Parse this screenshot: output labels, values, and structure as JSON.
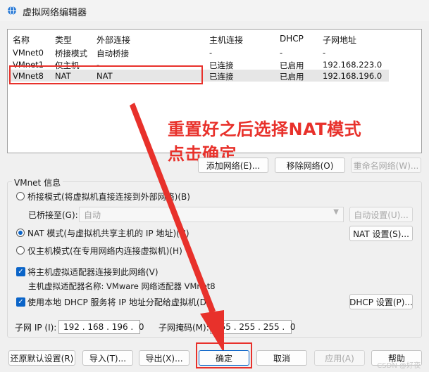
{
  "window": {
    "title": "虚拟网络编辑器",
    "icon": "globe-icon"
  },
  "table": {
    "headers": [
      "名称",
      "类型",
      "外部连接",
      "主机连接",
      "DHCP",
      "子网地址"
    ],
    "rows": [
      [
        "VMnet0",
        "桥接模式",
        "自动桥接",
        "-",
        "-",
        "-"
      ],
      [
        "VMnet1",
        "仅主机",
        "-",
        "已连接",
        "已启用",
        "192.168.223.0"
      ],
      [
        "VMnet8",
        "NAT",
        "NAT",
        "已连接",
        "已启用",
        "192.168.196.0"
      ]
    ],
    "selected_row": 2
  },
  "annotation": {
    "line1": "重置好之后选择NAT模式",
    "line2": "点击确定",
    "color": "#e8312b"
  },
  "network_buttons": {
    "add": "添加网络(E)...",
    "remove": "移除网络(O)",
    "rename": "重命名网络(W)..."
  },
  "vmnet_info": {
    "label": "VMnet 信息",
    "bridge_option": "桥接模式(将虚拟机直接连接到外部网络)(B)",
    "bridged_to_label": "已桥接至(G):",
    "bridged_to_value": "自动",
    "auto_settings": "自动设置(U)...",
    "nat_option": "NAT 模式(与虚拟机共享主机的 IP 地址)(N)",
    "nat_settings": "NAT 设置(S)...",
    "hostonly_option": "仅主机模式(在专用网络内连接虚拟机)(H)",
    "selected_mode": "nat",
    "connect_adapter": "将主机虚拟适配器连接到此网络(V)",
    "connect_adapter_checked": true,
    "adapter_name": "主机虚拟适配器名称: VMware 网络适配器 VMnet8",
    "use_dhcp": "使用本地 DHCP 服务将 IP 地址分配给虚拟机(D)",
    "use_dhcp_checked": true,
    "dhcp_settings": "DHCP 设置(P)...",
    "subnet_ip_label": "子网 IP (I):",
    "subnet_ip": "192 . 168 . 196 .  0",
    "subnet_mask_label": "子网掩码(M):",
    "subnet_mask": "255 . 255 . 255 .  0"
  },
  "footer": {
    "restore": "还原默认设置(R)",
    "import": "导入(T)...",
    "export": "导出(X)...",
    "ok": "确定",
    "cancel": "取消",
    "apply": "应用(A)",
    "help": "帮助"
  },
  "watermark": "CSDN @好夜"
}
